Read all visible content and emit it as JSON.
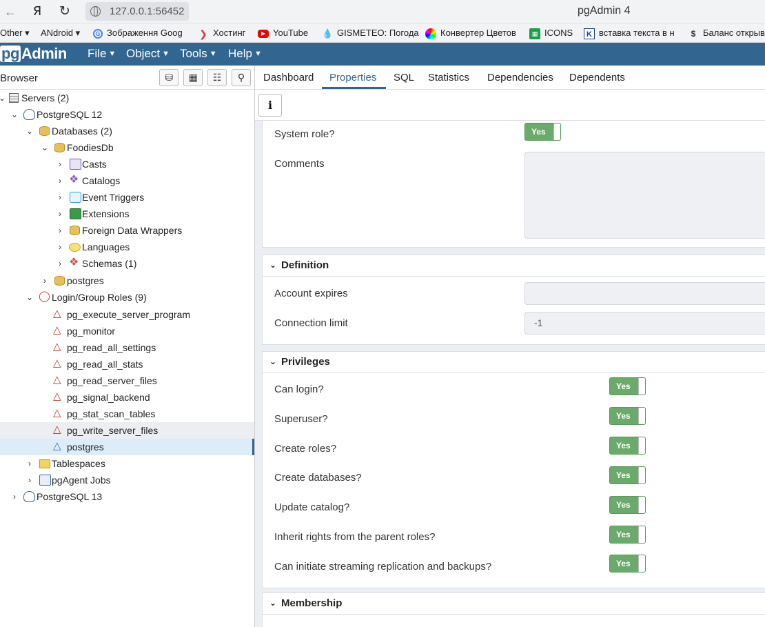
{
  "browser": {
    "address": "127.0.0.1:56452",
    "window_title": "pgAdmin 4",
    "bookmarks": [
      {
        "label": "Other ▾",
        "icon": "none"
      },
      {
        "label": "ANdroid ▾",
        "icon": "none"
      },
      {
        "label": "Зображення Goog",
        "icon": "google-icon"
      },
      {
        "label": "Хостинг",
        "icon": "chevron-icon"
      },
      {
        "label": "YouTube",
        "icon": "youtube-icon"
      },
      {
        "label": "GISMETEO: Погода",
        "icon": "drop-icon"
      },
      {
        "label": "Конвертер Цветов",
        "icon": "color-wheel-icon"
      },
      {
        "label": "ICONS",
        "icon": "icons-icon"
      },
      {
        "label": "вставка текста в н",
        "icon": "k-icon"
      },
      {
        "label": "Баланс открыв",
        "icon": "coin-icon"
      }
    ]
  },
  "app": {
    "logo_pg": "pg",
    "logo_rest": "Admin",
    "menus": [
      "File",
      "Object",
      "Tools",
      "Help"
    ]
  },
  "browser_panel": {
    "title": "Browser",
    "tree": [
      {
        "label": "Servers (2)",
        "icon": "servers-icon"
      },
      {
        "label": "PostgreSQL 12",
        "icon": "elephant-icon"
      },
      {
        "label": "Databases (2)",
        "icon": "databases-icon"
      },
      {
        "label": "FoodiesDb",
        "icon": "database-icon"
      },
      {
        "label": "Casts",
        "icon": "casts-icon"
      },
      {
        "label": "Catalogs",
        "icon": "catalogs-icon"
      },
      {
        "label": "Event Triggers",
        "icon": "event-triggers-icon"
      },
      {
        "label": "Extensions",
        "icon": "extensions-icon"
      },
      {
        "label": "Foreign Data Wrappers",
        "icon": "fdw-icon"
      },
      {
        "label": "Languages",
        "icon": "languages-icon"
      },
      {
        "label": "Schemas (1)",
        "icon": "schemas-icon"
      },
      {
        "label": "postgres",
        "icon": "database-icon"
      },
      {
        "label": "Login/Group Roles (9)",
        "icon": "roles-icon"
      },
      {
        "label": "pg_execute_server_program",
        "icon": "group-role-icon"
      },
      {
        "label": "pg_monitor",
        "icon": "group-role-icon"
      },
      {
        "label": "pg_read_all_settings",
        "icon": "group-role-icon"
      },
      {
        "label": "pg_read_all_stats",
        "icon": "group-role-icon"
      },
      {
        "label": "pg_read_server_files",
        "icon": "group-role-icon"
      },
      {
        "label": "pg_signal_backend",
        "icon": "group-role-icon"
      },
      {
        "label": "pg_stat_scan_tables",
        "icon": "group-role-icon"
      },
      {
        "label": "pg_write_server_files",
        "icon": "group-role-icon"
      },
      {
        "label": "postgres",
        "icon": "login-role-icon"
      },
      {
        "label": "Tablespaces",
        "icon": "tablespaces-icon"
      },
      {
        "label": "pgAgent Jobs",
        "icon": "pgagent-icon"
      },
      {
        "label": "PostgreSQL 13",
        "icon": "elephant-icon"
      }
    ]
  },
  "tabs": [
    "Dashboard",
    "Properties",
    "SQL",
    "Statistics",
    "Dependencies",
    "Dependents"
  ],
  "active_tab": "Properties",
  "info_button": "i",
  "general": {
    "system_role_label": "System role?",
    "system_role_value": "Yes",
    "comments_label": "Comments",
    "comments_value": ""
  },
  "definition": {
    "title": "Definition",
    "account_expires_label": "Account expires",
    "account_expires_value": "",
    "connection_limit_label": "Connection limit",
    "connection_limit_value": "-1"
  },
  "privileges": {
    "title": "Privileges",
    "items": [
      {
        "label": "Can login?",
        "value": "Yes"
      },
      {
        "label": "Superuser?",
        "value": "Yes"
      },
      {
        "label": "Create roles?",
        "value": "Yes"
      },
      {
        "label": "Create databases?",
        "value": "Yes"
      },
      {
        "label": "Update catalog?",
        "value": "Yes"
      },
      {
        "label": "Inherit rights from the parent roles?",
        "value": "Yes"
      },
      {
        "label": "Can initiate streaming replication and backups?",
        "value": "Yes"
      }
    ]
  },
  "membership": {
    "title": "Membership"
  },
  "colors": {
    "header_blue": "#326690",
    "toggle_green": "#6aaa6a",
    "content_bg": "#ebeef3"
  }
}
